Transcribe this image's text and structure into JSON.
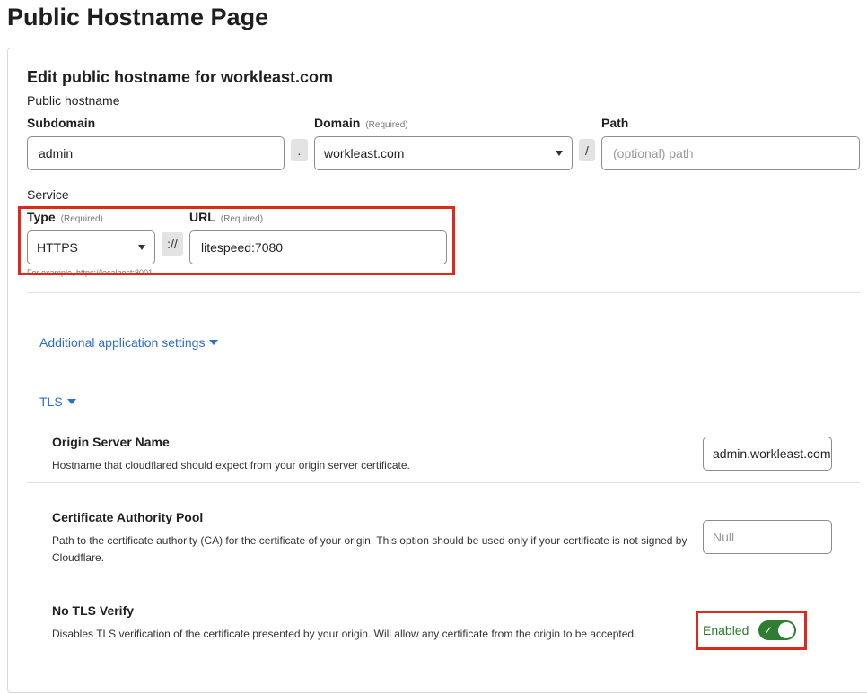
{
  "page_title": "Public Hostname Page",
  "form": {
    "title": "Edit public hostname for workleast.com",
    "public_hostname_label": "Public hostname",
    "subdomain": {
      "label": "Subdomain",
      "value": "admin"
    },
    "dot_separator": ".",
    "domain": {
      "label": "Domain",
      "required": "(Required)",
      "value": "workleast.com"
    },
    "slash_separator": "/",
    "path": {
      "label": "Path",
      "placeholder": "(optional) path"
    },
    "service_label": "Service",
    "type": {
      "label": "Type",
      "required": "(Required)",
      "value": "HTTPS"
    },
    "scheme_separator": "://",
    "url": {
      "label": "URL",
      "required": "(Required)",
      "value": "litespeed:7080"
    },
    "url_hint": "For example, https://localhost:8001"
  },
  "additional_settings": {
    "label": "Additional application settings"
  },
  "tls": {
    "label": "TLS",
    "origin_server_name": {
      "title": "Origin Server Name",
      "description": "Hostname that cloudflared should expect from your origin server certificate.",
      "value": "admin.workleast.com"
    },
    "ca_pool": {
      "title": "Certificate Authority Pool",
      "description": "Path to the certificate authority (CA) for the certificate of your origin. This option should be used only if your certificate is not signed by Cloudflare.",
      "placeholder": "Null"
    },
    "no_tls_verify": {
      "title": "No TLS Verify",
      "description": "Disables TLS verification of the certificate presented by your origin. Will allow any certificate from the origin to be accepted.",
      "status": "Enabled",
      "enabled": true
    }
  },
  "colors": {
    "highlight": "#e0291d",
    "link": "#2f6ecb",
    "toggle_on": "#2e7d32"
  }
}
